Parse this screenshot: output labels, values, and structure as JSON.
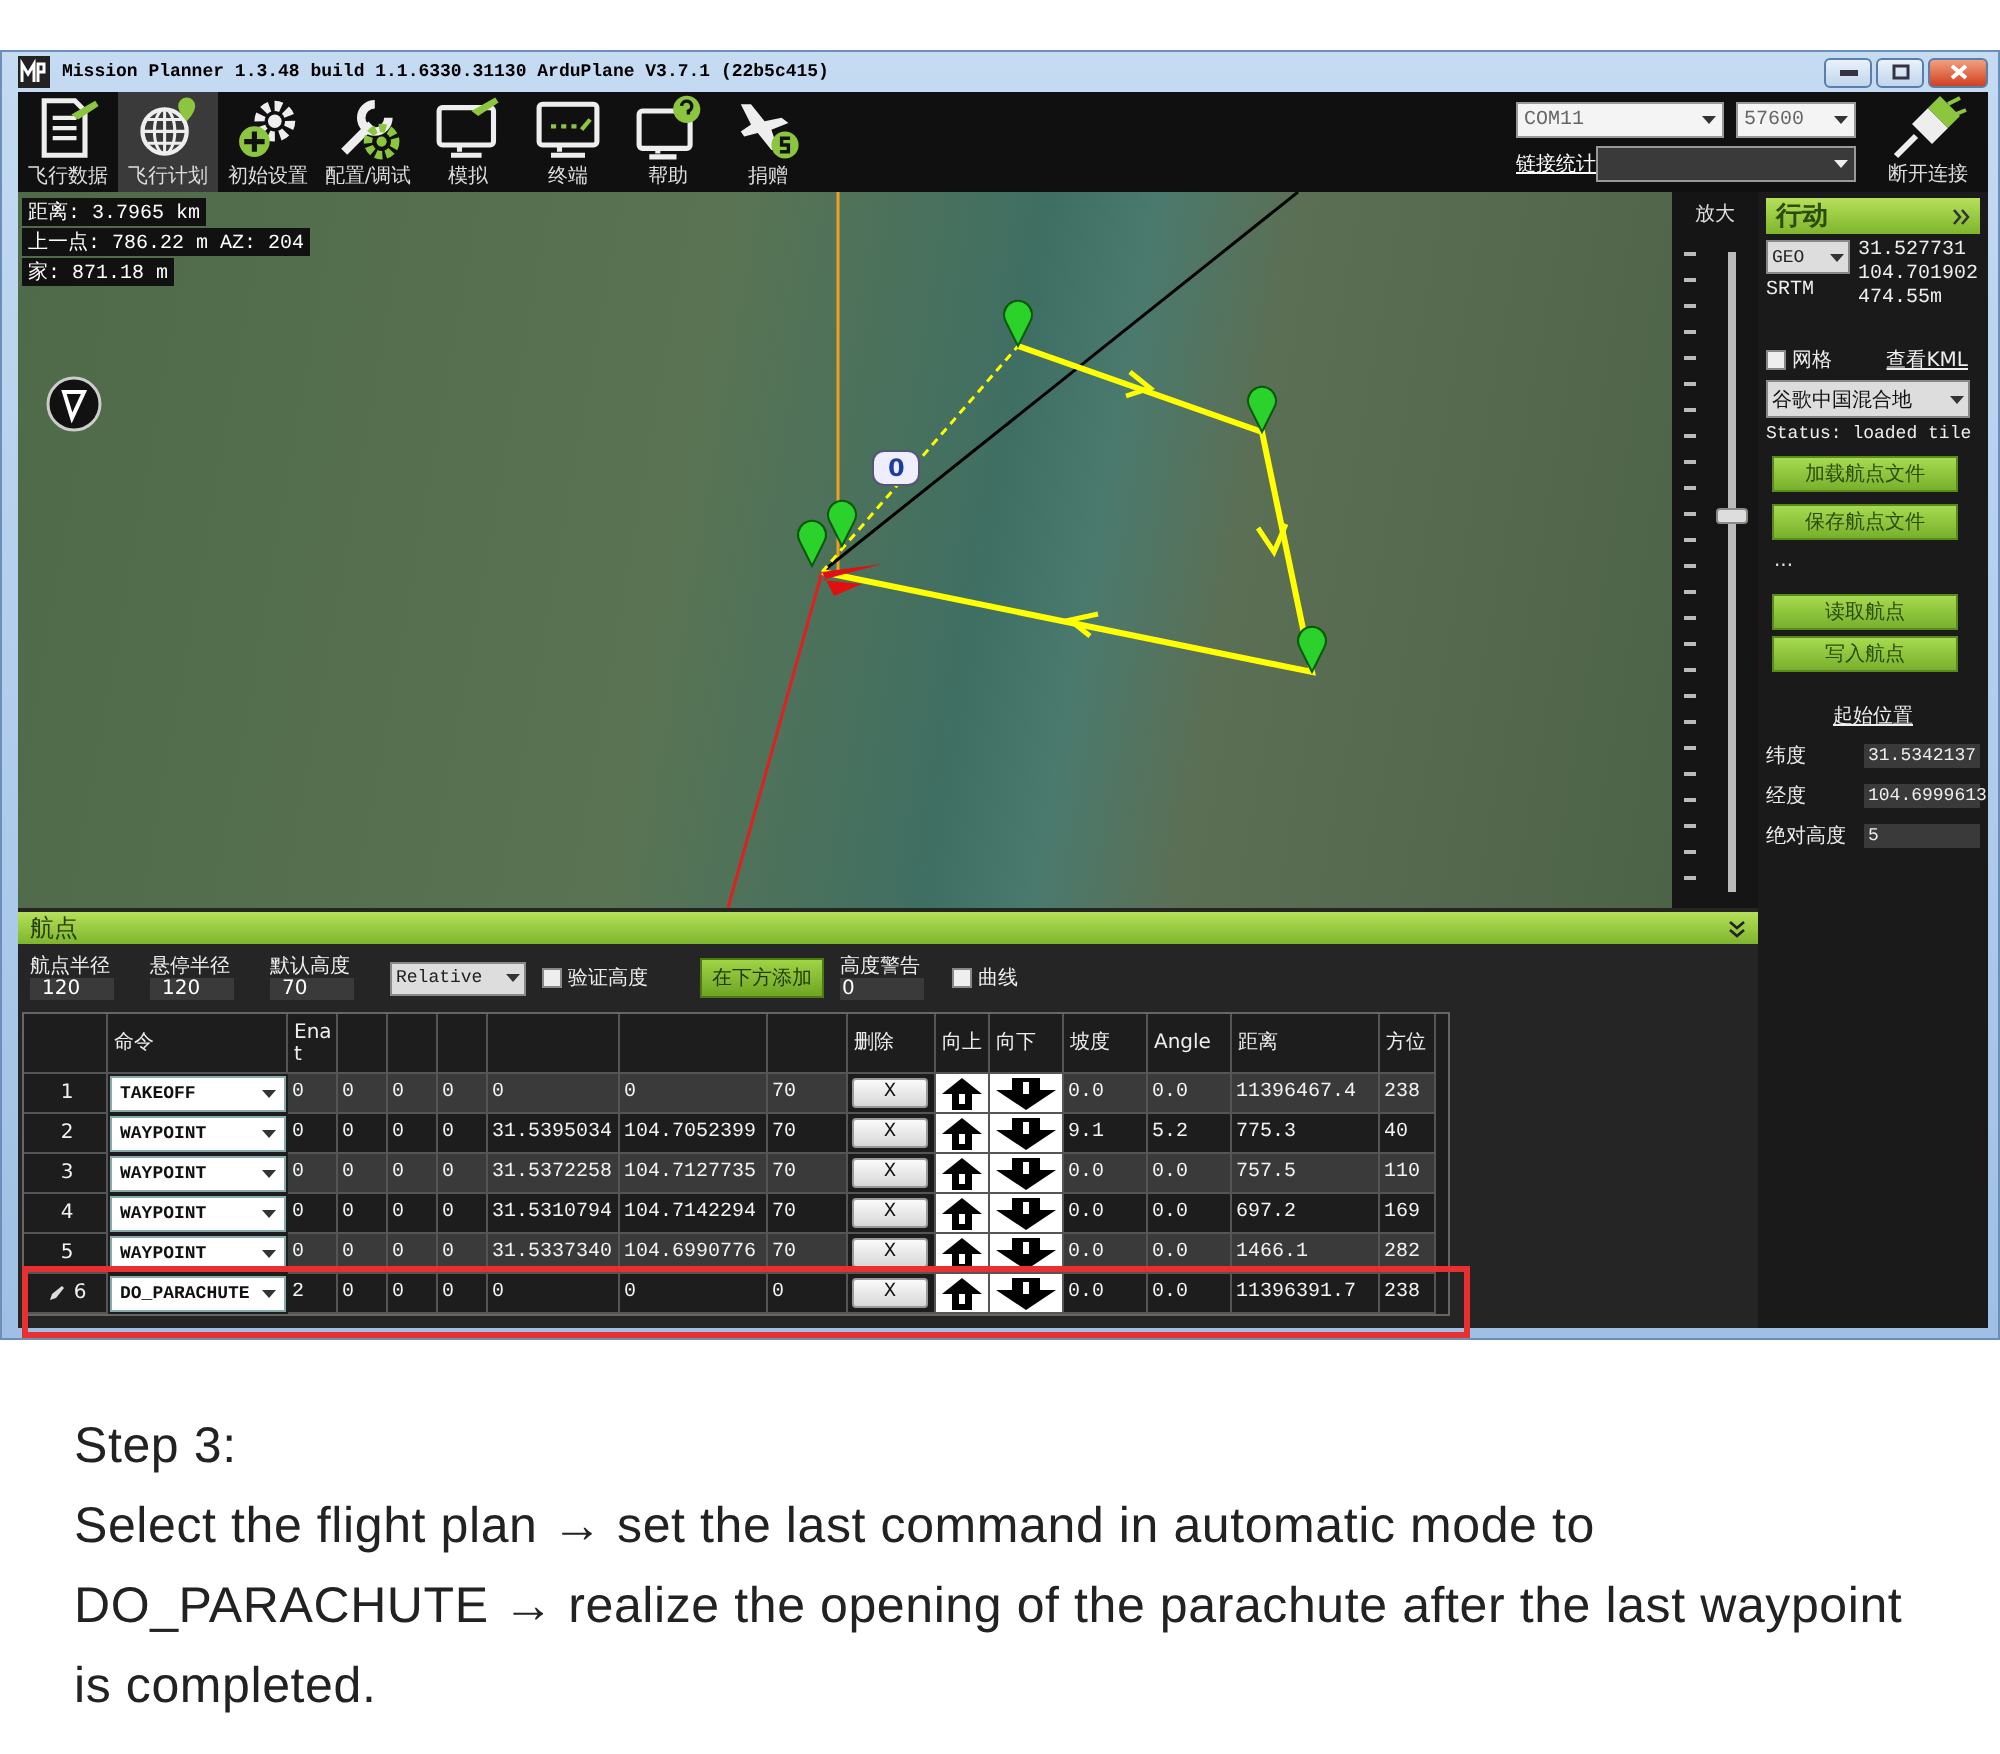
{
  "window": {
    "title": "Mission Planner 1.3.48 build 1.1.6330.31130 ArduPlane V3.7.1 (22b5c415)"
  },
  "toolbar": {
    "items": [
      {
        "label": "飞行数据",
        "kind": "document",
        "selected": false
      },
      {
        "label": "飞行计划",
        "kind": "globe",
        "selected": true
      },
      {
        "label": "初始设置",
        "kind": "gear",
        "selected": false
      },
      {
        "label": "配置/调试",
        "kind": "wrench",
        "selected": false
      },
      {
        "label": "模拟",
        "kind": "monitor",
        "selected": false
      },
      {
        "label": "终端",
        "kind": "terminal",
        "selected": false
      },
      {
        "label": "帮助",
        "kind": "help",
        "selected": false
      },
      {
        "label": "捐赠",
        "kind": "plane",
        "selected": false
      }
    ]
  },
  "connection": {
    "port": "COM11",
    "baud": "57600",
    "link_stats": "链接统计",
    "disconnect": "断开连接"
  },
  "map": {
    "distance": "距离: 3.7965 km",
    "previous": "上一点: 786.22 m AZ: 204",
    "home": "家: 871.18 m",
    "home_label": "0"
  },
  "zoom": {
    "label": "放大",
    "level": 0.59
  },
  "action_panel": {
    "title": "行动",
    "frame": "GEO",
    "lat": "31.527731",
    "lon": "104.701902",
    "alt": "474.55m",
    "source": "SRTM",
    "grid": {
      "label": "网格",
      "checked": false
    },
    "kml_link": "查看KML",
    "map_type": "谷歌中国混合地",
    "status": "Status: loaded tile",
    "file_buttons": [
      "加载航点文件",
      "保存航点文件"
    ],
    "more": "...",
    "wp_buttons": [
      "读取航点",
      "写入航点"
    ],
    "home_link": "起始位置",
    "home_fields": [
      {
        "label": "纬度",
        "value": "31.5342137"
      },
      {
        "label": "经度",
        "value": "104.6999613"
      },
      {
        "label": "绝对高度",
        "value": "5"
      }
    ]
  },
  "waypoints": {
    "title": "航点",
    "settings": [
      {
        "label": "航点半径",
        "value": "120"
      },
      {
        "label": "悬停半径",
        "value": "120"
      },
      {
        "label": "默认高度",
        "value": "70"
      }
    ],
    "alt_frame": "Relative",
    "verify_height": {
      "label": "验证高度",
      "checked": false
    },
    "add_below": "在下方添加",
    "alt_warning": {
      "label": "高度警告",
      "value": "0"
    },
    "spline": {
      "label": "曲线",
      "checked": false
    },
    "columns": {
      "command": "命令",
      "param_1": "Enat",
      "delete": "删除",
      "up": "向上",
      "down": "向下",
      "grade": "坡度",
      "angle": "Angle",
      "distance": "距离",
      "bearing": "方位"
    },
    "rows": [
      {
        "num": "1",
        "command": "TAKEOFF",
        "params": [
          "0",
          "0",
          "0",
          "0"
        ],
        "lat": "0",
        "lon": "0",
        "alt": "70",
        "delete": "X",
        "grade": "0.0",
        "angle": "0.0",
        "distance": "11396467.4",
        "bearing": "238",
        "editing": false,
        "highlighted": false
      },
      {
        "num": "2",
        "command": "WAYPOINT",
        "params": [
          "0",
          "0",
          "0",
          "0"
        ],
        "lat": "31.5395034",
        "lon": "104.7052399",
        "alt": "70",
        "delete": "X",
        "grade": "9.1",
        "angle": "5.2",
        "distance": "775.3",
        "bearing": "40",
        "editing": false,
        "highlighted": false
      },
      {
        "num": "3",
        "command": "WAYPOINT",
        "params": [
          "0",
          "0",
          "0",
          "0"
        ],
        "lat": "31.5372258",
        "lon": "104.7127735",
        "alt": "70",
        "delete": "X",
        "grade": "0.0",
        "angle": "0.0",
        "distance": "757.5",
        "bearing": "110",
        "editing": false,
        "highlighted": false
      },
      {
        "num": "4",
        "command": "WAYPOINT",
        "params": [
          "0",
          "0",
          "0",
          "0"
        ],
        "lat": "31.5310794",
        "lon": "104.7142294",
        "alt": "70",
        "delete": "X",
        "grade": "0.0",
        "angle": "0.0",
        "distance": "697.2",
        "bearing": "169",
        "editing": false,
        "highlighted": false
      },
      {
        "num": "5",
        "command": "WAYPOINT",
        "params": [
          "0",
          "0",
          "0",
          "0"
        ],
        "lat": "31.5337340",
        "lon": "104.6990776",
        "alt": "70",
        "delete": "X",
        "grade": "0.0",
        "angle": "0.0",
        "distance": "1466.1",
        "bearing": "282",
        "editing": false,
        "highlighted": false
      },
      {
        "num": "6",
        "command": "DO_PARACHUTE",
        "params": [
          "2",
          "0",
          "0",
          "0"
        ],
        "lat": "0",
        "lon": "0",
        "alt": "0",
        "delete": "X",
        "grade": "0.0",
        "angle": "0.0",
        "distance": "11396391.7",
        "bearing": "238",
        "editing": true,
        "highlighted": true
      }
    ]
  },
  "caption": {
    "step": "Step 3:",
    "text": "Select the flight plan → set the last command in automatic mode to DO_PARACHUTE → realize the opening of the parachute after the last waypoint is completed."
  }
}
